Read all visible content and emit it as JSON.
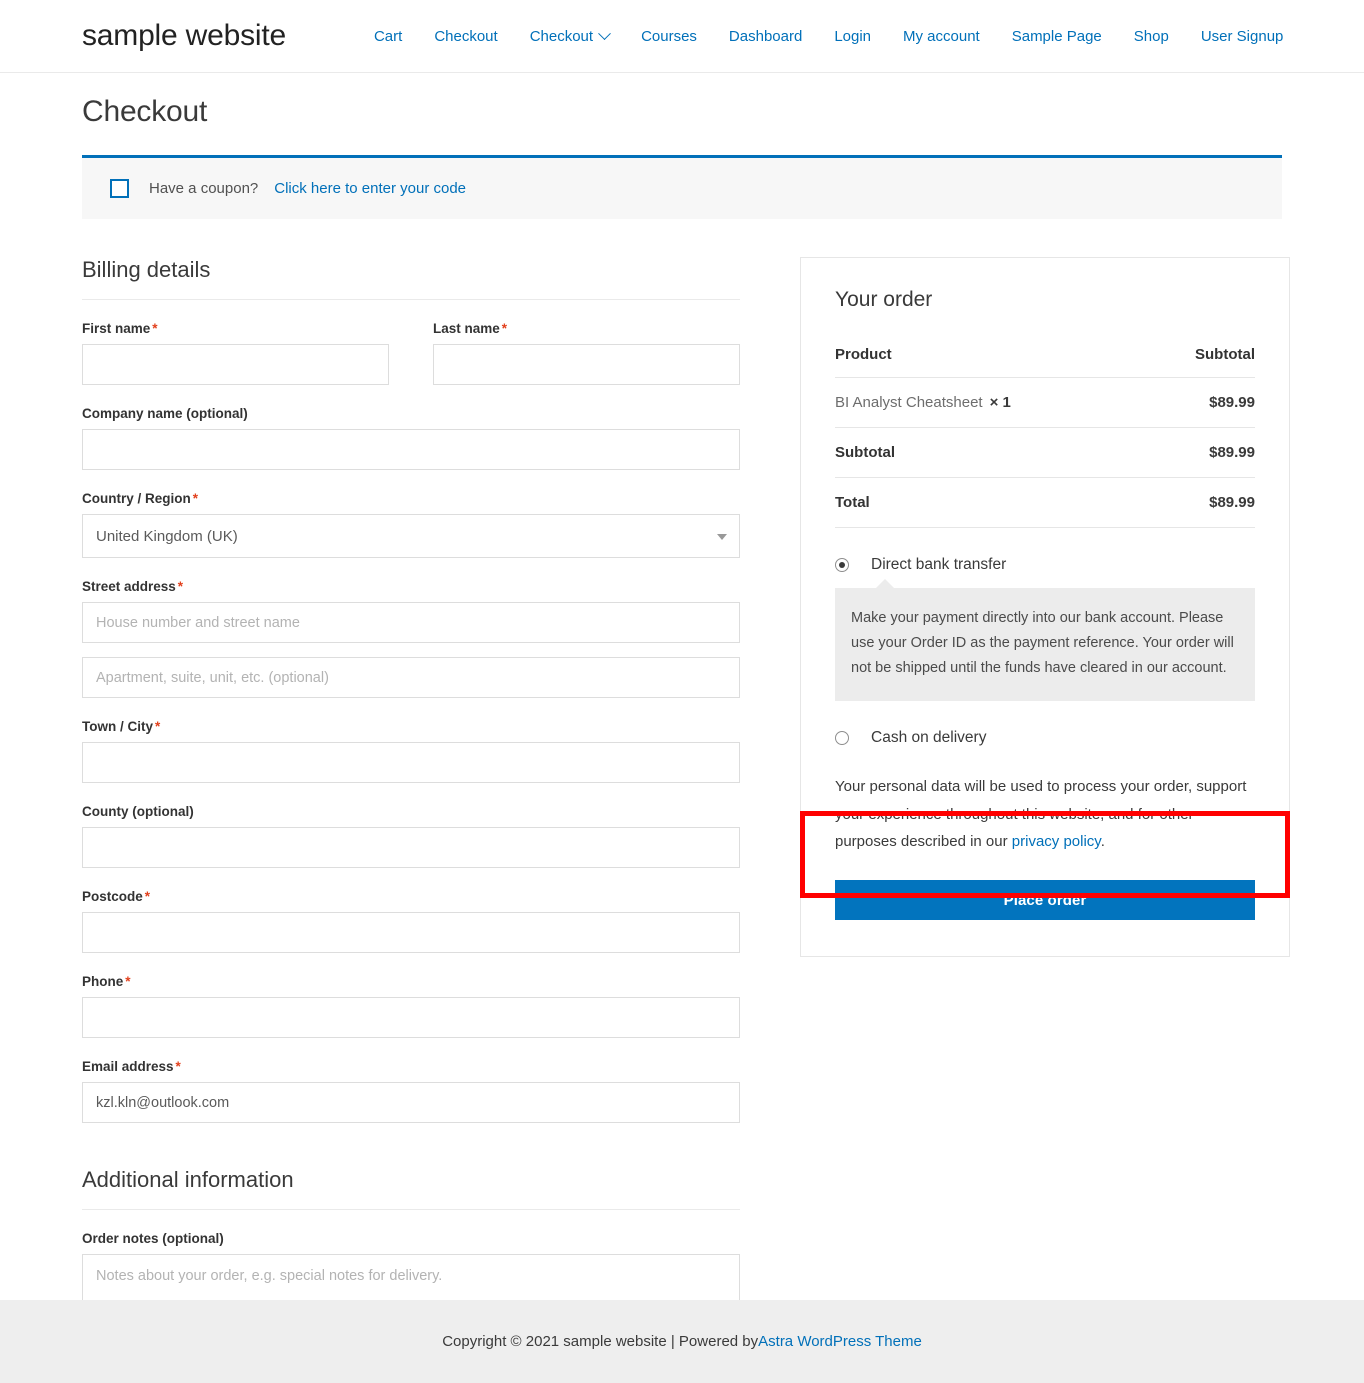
{
  "header": {
    "site_title": "sample website",
    "nav": [
      {
        "label": "Cart",
        "has_dropdown": false
      },
      {
        "label": "Checkout",
        "has_dropdown": false
      },
      {
        "label": "Checkout",
        "has_dropdown": true
      },
      {
        "label": "Courses",
        "has_dropdown": false
      },
      {
        "label": "Dashboard",
        "has_dropdown": false
      },
      {
        "label": "Login",
        "has_dropdown": false
      },
      {
        "label": "My account",
        "has_dropdown": false
      },
      {
        "label": "Sample Page",
        "has_dropdown": false
      },
      {
        "label": "Shop",
        "has_dropdown": false
      },
      {
        "label": "User Signup",
        "has_dropdown": false
      }
    ]
  },
  "page": {
    "title": "Checkout"
  },
  "coupon": {
    "icon": "coupon-tag-icon",
    "text": "Have a coupon?",
    "link_label": "Click here to enter your code"
  },
  "billing": {
    "heading": "Billing details",
    "first_name": {
      "label": "First name",
      "required": true,
      "value": "",
      "placeholder": ""
    },
    "last_name": {
      "label": "Last name",
      "required": true,
      "value": "",
      "placeholder": ""
    },
    "company": {
      "label": "Company name (optional)",
      "required": false,
      "value": "",
      "placeholder": ""
    },
    "country": {
      "label": "Country / Region",
      "required": true,
      "value": "United Kingdom (UK)"
    },
    "street": {
      "label": "Street address",
      "required": true,
      "placeholder1": "House number and street name",
      "placeholder2": "Apartment, suite, unit, etc. (optional)",
      "value1": "",
      "value2": ""
    },
    "city": {
      "label": "Town / City",
      "required": true,
      "value": "",
      "placeholder": ""
    },
    "county": {
      "label": "County (optional)",
      "required": false,
      "value": "",
      "placeholder": ""
    },
    "postcode": {
      "label": "Postcode",
      "required": true,
      "value": "",
      "placeholder": ""
    },
    "phone": {
      "label": "Phone",
      "required": true,
      "value": "",
      "placeholder": ""
    },
    "email": {
      "label": "Email address",
      "required": true,
      "value": "kzl.kln@outlook.com",
      "placeholder": ""
    }
  },
  "additional": {
    "heading": "Additional information",
    "order_notes": {
      "label": "Order notes (optional)",
      "placeholder": "Notes about your order, e.g. special notes for delivery.",
      "value": ""
    }
  },
  "order": {
    "title": "Your order",
    "columns": {
      "product": "Product",
      "subtotal": "Subtotal"
    },
    "items": [
      {
        "name": "BI Analyst Cheatsheet",
        "qty_symbol": "×",
        "qty": "1",
        "amount": "$89.99"
      }
    ],
    "subtotal": {
      "label": "Subtotal",
      "amount": "$89.99"
    },
    "total": {
      "label": "Total",
      "amount": "$89.99"
    },
    "payment_methods": [
      {
        "label": "Direct bank transfer",
        "selected": true,
        "description": "Make your payment directly into our bank account. Please use your Order ID as the payment reference. Your order will not be shipped until the funds have cleared in our account."
      },
      {
        "label": "Cash on delivery",
        "selected": false,
        "description": ""
      }
    ],
    "privacy_text_before": "Your personal data will be used to process your order, support your experience throughout this website, and for other purposes described in our ",
    "privacy_link": "privacy policy",
    "privacy_text_after": ".",
    "place_order_label": "Place order"
  },
  "footer": {
    "text_before": "Copyright © 2021 sample website | Powered by ",
    "link_label": "Astra WordPress Theme"
  },
  "colors": {
    "accent_blue": "#0170B9",
    "button_blue": "#0274BE",
    "required_red": "#e2401c",
    "highlight_red": "#ff0000",
    "footer_bg": "#eeeeee",
    "coupon_bg": "#f7f7f7"
  }
}
